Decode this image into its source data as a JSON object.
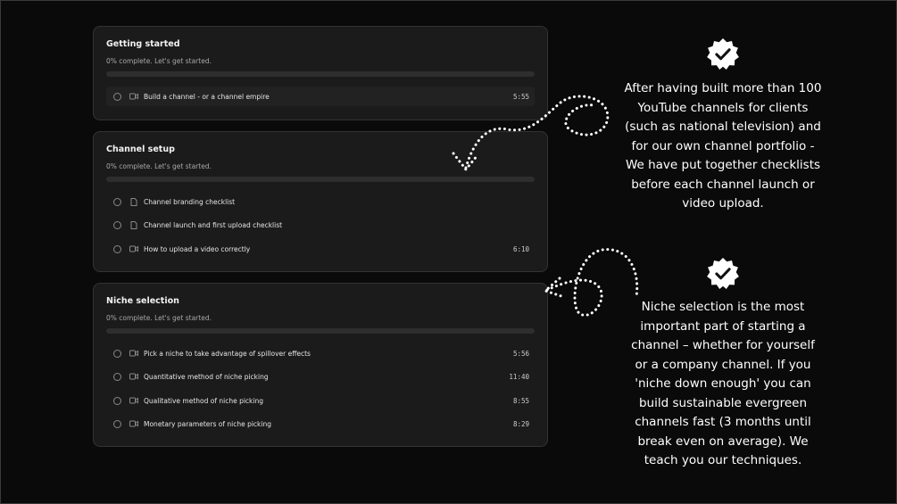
{
  "sections": [
    {
      "title": "Getting started",
      "progress_text": "0% complete. Let's get started.",
      "progress": 0,
      "lessons": [
        {
          "label": "Build a channel - or a channel empire",
          "icon": "video-icon",
          "duration": "5:55"
        }
      ]
    },
    {
      "title": "Channel setup",
      "progress_text": "0% complete. Let's get started.",
      "progress": 0,
      "lessons": [
        {
          "label": "Channel branding checklist",
          "icon": "document-icon",
          "duration": ""
        },
        {
          "label": "Channel launch and first upload checklist",
          "icon": "document-icon",
          "duration": ""
        },
        {
          "label": "How to upload a video correctly",
          "icon": "video-icon",
          "duration": "6:10"
        }
      ]
    },
    {
      "title": "Niche selection",
      "progress_text": "0% complete. Let's get started.",
      "progress": 0,
      "lessons": [
        {
          "label": "Pick a niche to take advantage of spillover effects",
          "icon": "video-icon",
          "duration": "5:56"
        },
        {
          "label": "Quantitative method of niche picking",
          "icon": "video-icon",
          "duration": "11:40"
        },
        {
          "label": "Qualitative method of niche picking",
          "icon": "video-icon",
          "duration": "8:55"
        },
        {
          "label": "Monetary parameters of niche picking",
          "icon": "video-icon",
          "duration": "8:29"
        }
      ]
    }
  ],
  "callouts": [
    {
      "icon": "verified-badge-icon",
      "lines": [
        "After having built more than 100",
        "YouTube channels for clients",
        "(such as national television) and",
        "for our own channel portfolio -",
        "We have put together checklists",
        "before each channel launch or",
        "video upload."
      ]
    },
    {
      "icon": "verified-badge-icon",
      "lines": [
        "Niche selection is the most",
        "important part of starting a",
        "channel – whether for yourself",
        "or a company channel. If you",
        "'niche down enough' you can",
        "build sustainable evergreen",
        "channels fast (3 months until",
        "break even on average). We",
        "teach you our techniques."
      ]
    }
  ],
  "colors": {
    "background": "#000000",
    "card": "#1b1b1c",
    "text": "#ffffff"
  }
}
